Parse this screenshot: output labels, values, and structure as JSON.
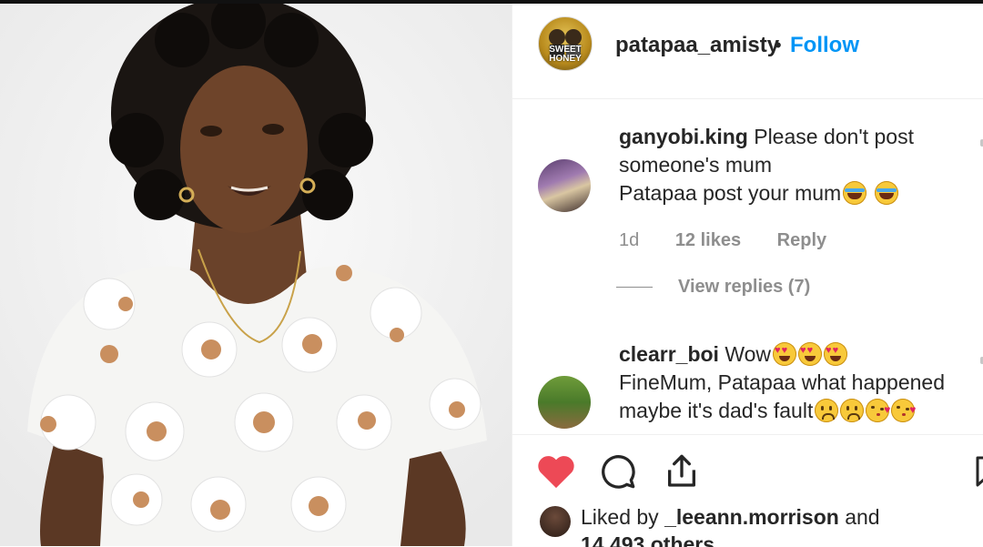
{
  "post": {
    "author": "patapaa_amisty",
    "separator": "•",
    "follow_label": "Follow",
    "avatar_text": "SWEET HONEY"
  },
  "comments": [
    {
      "username": "ganyobi.king",
      "line1": "Please don't post",
      "line2": "someone's mum",
      "line3": "Patapaa post your mum",
      "emojis": [
        "grinning-squinting-tears-emoji",
        "grinning-squinting-tears-emoji"
      ],
      "age": "1d",
      "likes": "12 likes",
      "reply_label": "Reply",
      "view_replies": "View replies (7)"
    },
    {
      "username": "clearr_boi",
      "line1": "Wow",
      "line1_emojis": [
        "heart-eyes-emoji",
        "heart-eyes-emoji",
        "heart-eyes-emoji"
      ],
      "line2": "FineMum, Patapaa what happened",
      "line3": "maybe it's dad's fault",
      "line3_emojis": [
        "frowning-emoji",
        "frowning-emoji",
        "blowing-kiss-emoji",
        "blowing-kiss-emoji"
      ]
    }
  ],
  "actions": {
    "icons": [
      "heart-icon",
      "comment-icon",
      "share-icon",
      "bookmark-icon"
    ],
    "like_color": "#ed4956",
    "liked_by_prefix": "Liked by",
    "liked_by_user": "_leeann.morrison",
    "liked_by_and": "and",
    "others": "14,493 others"
  },
  "colors": {
    "follow": "#0095f6",
    "muted": "#8e8e8e",
    "text": "#262626"
  }
}
